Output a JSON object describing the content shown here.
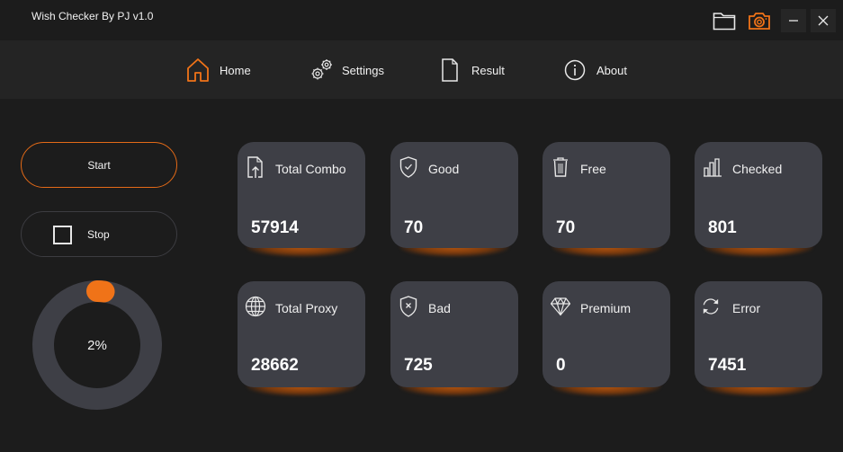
{
  "window": {
    "title": "Wish Checker By PJ v1.0",
    "icons": [
      "folder-icon",
      "camera-icon"
    ],
    "minimize_symbol": "–",
    "close_symbol": "✕"
  },
  "nav": {
    "items": [
      {
        "label": "Home",
        "icon": "home-icon",
        "active": true
      },
      {
        "label": "Settings",
        "icon": "gears-icon",
        "active": false
      },
      {
        "label": "Result",
        "icon": "document-icon",
        "active": false
      },
      {
        "label": "About",
        "icon": "info-icon",
        "active": false
      }
    ]
  },
  "controls": {
    "start_label": "Start",
    "stop_label": "Stop"
  },
  "progress": {
    "percent": 2,
    "label": "2%"
  },
  "stats": [
    {
      "label": "Total Combo",
      "value": "57914",
      "icon": "file-upload-icon"
    },
    {
      "label": "Good",
      "value": "70",
      "icon": "shield-check-icon"
    },
    {
      "label": "Free",
      "value": "70",
      "icon": "trash-icon"
    },
    {
      "label": "Checked",
      "value": "801",
      "icon": "bar-chart-icon"
    },
    {
      "label": "Total Proxy",
      "value": "28662",
      "icon": "globe-icon"
    },
    {
      "label": "Bad",
      "value": "725",
      "icon": "shield-x-icon"
    },
    {
      "label": "Premium",
      "value": "0",
      "icon": "diamond-icon"
    },
    {
      "label": "Error",
      "value": "7451",
      "icon": "refresh-icon"
    }
  ],
  "colors": {
    "accent": "#f07318",
    "background": "#1c1c1c",
    "navbar": "#242424",
    "card": "#3e3f46",
    "ring": "#3e3f46"
  }
}
